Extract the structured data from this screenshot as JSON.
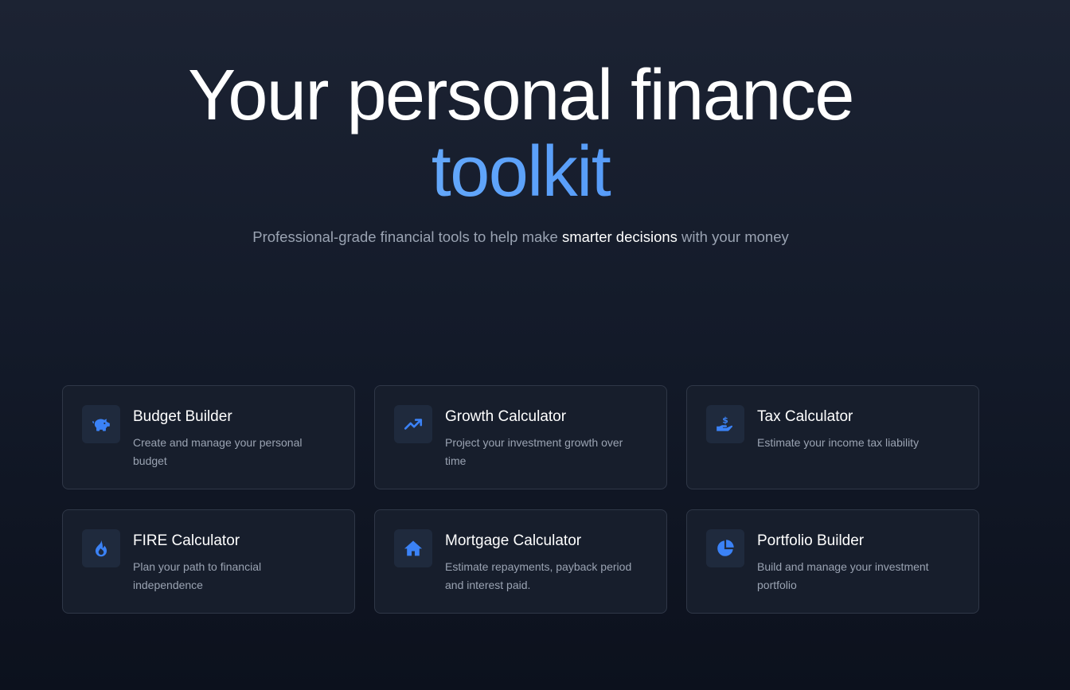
{
  "hero": {
    "title_line1": "Your personal finance",
    "title_line2": "toolkit",
    "subtitle_before": "Professional-grade financial tools to help make ",
    "subtitle_highlight": "smarter decisions",
    "subtitle_after": " with your money"
  },
  "colors": {
    "accent": "#3b82f6",
    "accent_light": "#93c5fd",
    "card_bg": "#171e2c",
    "card_border": "#2f3747",
    "icon_bg": "#1f2a3d",
    "muted_text": "#9aa3b2"
  },
  "tools": [
    {
      "icon": "piggy-bank-icon",
      "title": "Budget Builder",
      "description": "Create and manage your personal budget"
    },
    {
      "icon": "trending-up-icon",
      "title": "Growth Calculator",
      "description": "Project your investment growth over time"
    },
    {
      "icon": "hand-dollar-icon",
      "title": "Tax Calculator",
      "description": "Estimate your income tax liability"
    },
    {
      "icon": "fire-icon",
      "title": "FIRE Calculator",
      "description": "Plan your path to financial independence"
    },
    {
      "icon": "home-icon",
      "title": "Mortgage Calculator",
      "description": "Estimate repayments, payback period and interest paid."
    },
    {
      "icon": "pie-chart-icon",
      "title": "Portfolio Builder",
      "description": "Build and manage your investment portfolio"
    }
  ]
}
